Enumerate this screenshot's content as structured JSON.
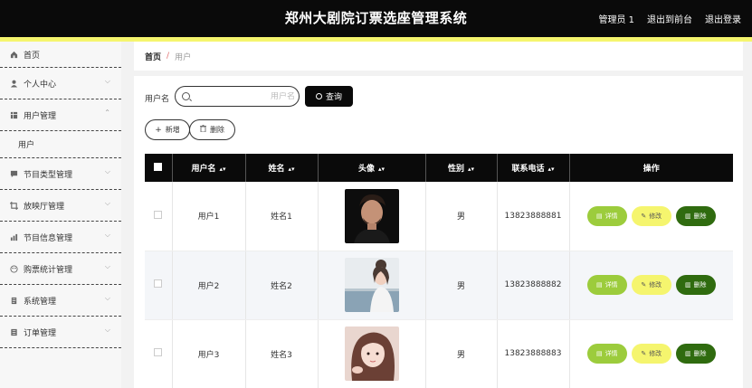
{
  "header": {
    "title": "郑州大剧院订票选座管理系统",
    "user_label": "管理员 1",
    "frontend_link": "退出到前台",
    "logout_link": "退出登录"
  },
  "sidebar": {
    "items": [
      {
        "label": "首页",
        "icon": "home-icon"
      },
      {
        "label": "个人中心",
        "icon": "user-icon"
      },
      {
        "label": "用户管理",
        "icon": "table-icon",
        "expanded": true,
        "sub": "用户"
      },
      {
        "label": "节目类型管理",
        "icon": "comment-icon"
      },
      {
        "label": "放映厅管理",
        "icon": "crop-icon"
      },
      {
        "label": "节目信息管理",
        "icon": "chart-icon"
      },
      {
        "label": "购票统计管理",
        "icon": "palette-icon"
      },
      {
        "label": "系统管理",
        "icon": "document-icon"
      },
      {
        "label": "订单管理",
        "icon": "list-icon"
      }
    ]
  },
  "breadcrumb": {
    "home": "首页",
    "separator": "/",
    "current": "用户"
  },
  "search": {
    "label": "用户名",
    "placeholder": "用户名",
    "value": "",
    "query_button": "查询"
  },
  "actions": {
    "add": "新增",
    "delete": "删除"
  },
  "table": {
    "columns": [
      "用户名",
      "姓名",
      "头像",
      "性别",
      "联系电话",
      "操作"
    ],
    "rows": [
      {
        "username": "用户1",
        "name": "姓名1",
        "gender": "男",
        "phone": "13823888881"
      },
      {
        "username": "用户2",
        "name": "姓名2",
        "gender": "男",
        "phone": "13823888882"
      },
      {
        "username": "用户3",
        "name": "姓名3",
        "gender": "男",
        "phone": "13823888883"
      }
    ],
    "row_actions": {
      "detail": "详情",
      "edit": "修改",
      "delete": "删除"
    }
  },
  "colors": {
    "header_bg": "#0a0a0a",
    "accent_yellow": "#f5f56e",
    "detail_green": "#9ccc3c",
    "delete_green": "#2f6b0f"
  }
}
